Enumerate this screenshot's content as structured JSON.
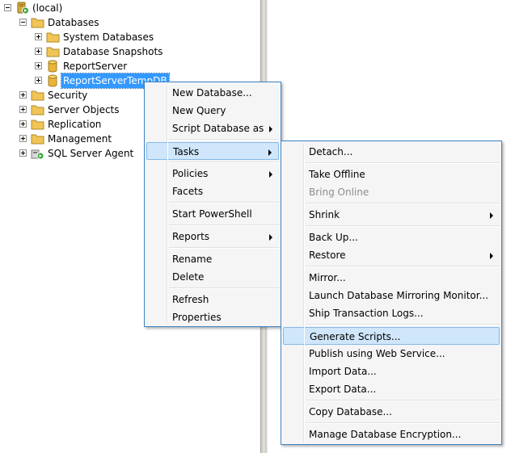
{
  "tree": {
    "root": "(local)",
    "databases": "Databases",
    "system_databases": "System Databases",
    "database_snapshots": "Database Snapshots",
    "report_server": "ReportServer",
    "report_server_temp": "ReportServerTempDB",
    "security": "Security",
    "server_objects": "Server Objects",
    "replication": "Replication",
    "management": "Management",
    "sql_agent": "SQL Server Agent"
  },
  "context_menu": {
    "new_database": "New Database...",
    "new_query": "New Query",
    "script_database_as": "Script Database as",
    "tasks": "Tasks",
    "policies": "Policies",
    "facets": "Facets",
    "start_powershell": "Start PowerShell",
    "reports": "Reports",
    "rename": "Rename",
    "delete": "Delete",
    "refresh": "Refresh",
    "properties": "Properties"
  },
  "tasks_menu": {
    "detach": "Detach...",
    "take_offline": "Take Offline",
    "bring_online": "Bring Online",
    "shrink": "Shrink",
    "back_up": "Back Up...",
    "restore": "Restore",
    "mirror": "Mirror...",
    "launch_mirroring_monitor": "Launch Database Mirroring Monitor...",
    "ship_transaction_logs": "Ship Transaction Logs...",
    "generate_scripts": "Generate Scripts...",
    "publish_web_service": "Publish using Web Service...",
    "import_data": "Import Data...",
    "export_data": "Export Data...",
    "copy_database": "Copy Database...",
    "manage_encryption": "Manage Database Encryption..."
  },
  "colors": {
    "selection": "#3399ff",
    "menu_highlight": "#cfe6fb",
    "menu_border": "#3d84c6",
    "folder": "#f0c556"
  },
  "icons": {
    "server": "server-icon",
    "folder": "folder-icon",
    "database": "database-icon",
    "agent": "sql-agent-icon"
  }
}
